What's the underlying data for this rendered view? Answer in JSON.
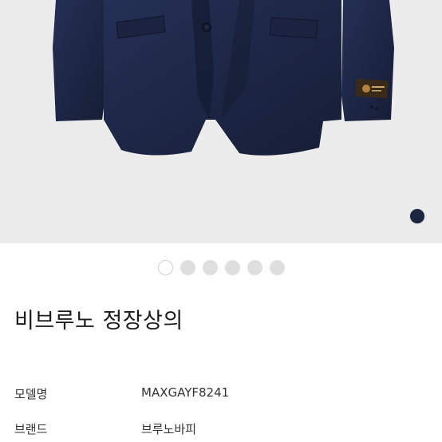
{
  "product": {
    "title": "비브루노 정장상의",
    "colors": [
      "#1d2540"
    ],
    "gallery": {
      "count": 6,
      "active_index": 0
    }
  },
  "specs": [
    {
      "label": "모델명",
      "value": "MAXGAYF8241"
    },
    {
      "label": "브랜드",
      "value": "브루노바피"
    }
  ]
}
